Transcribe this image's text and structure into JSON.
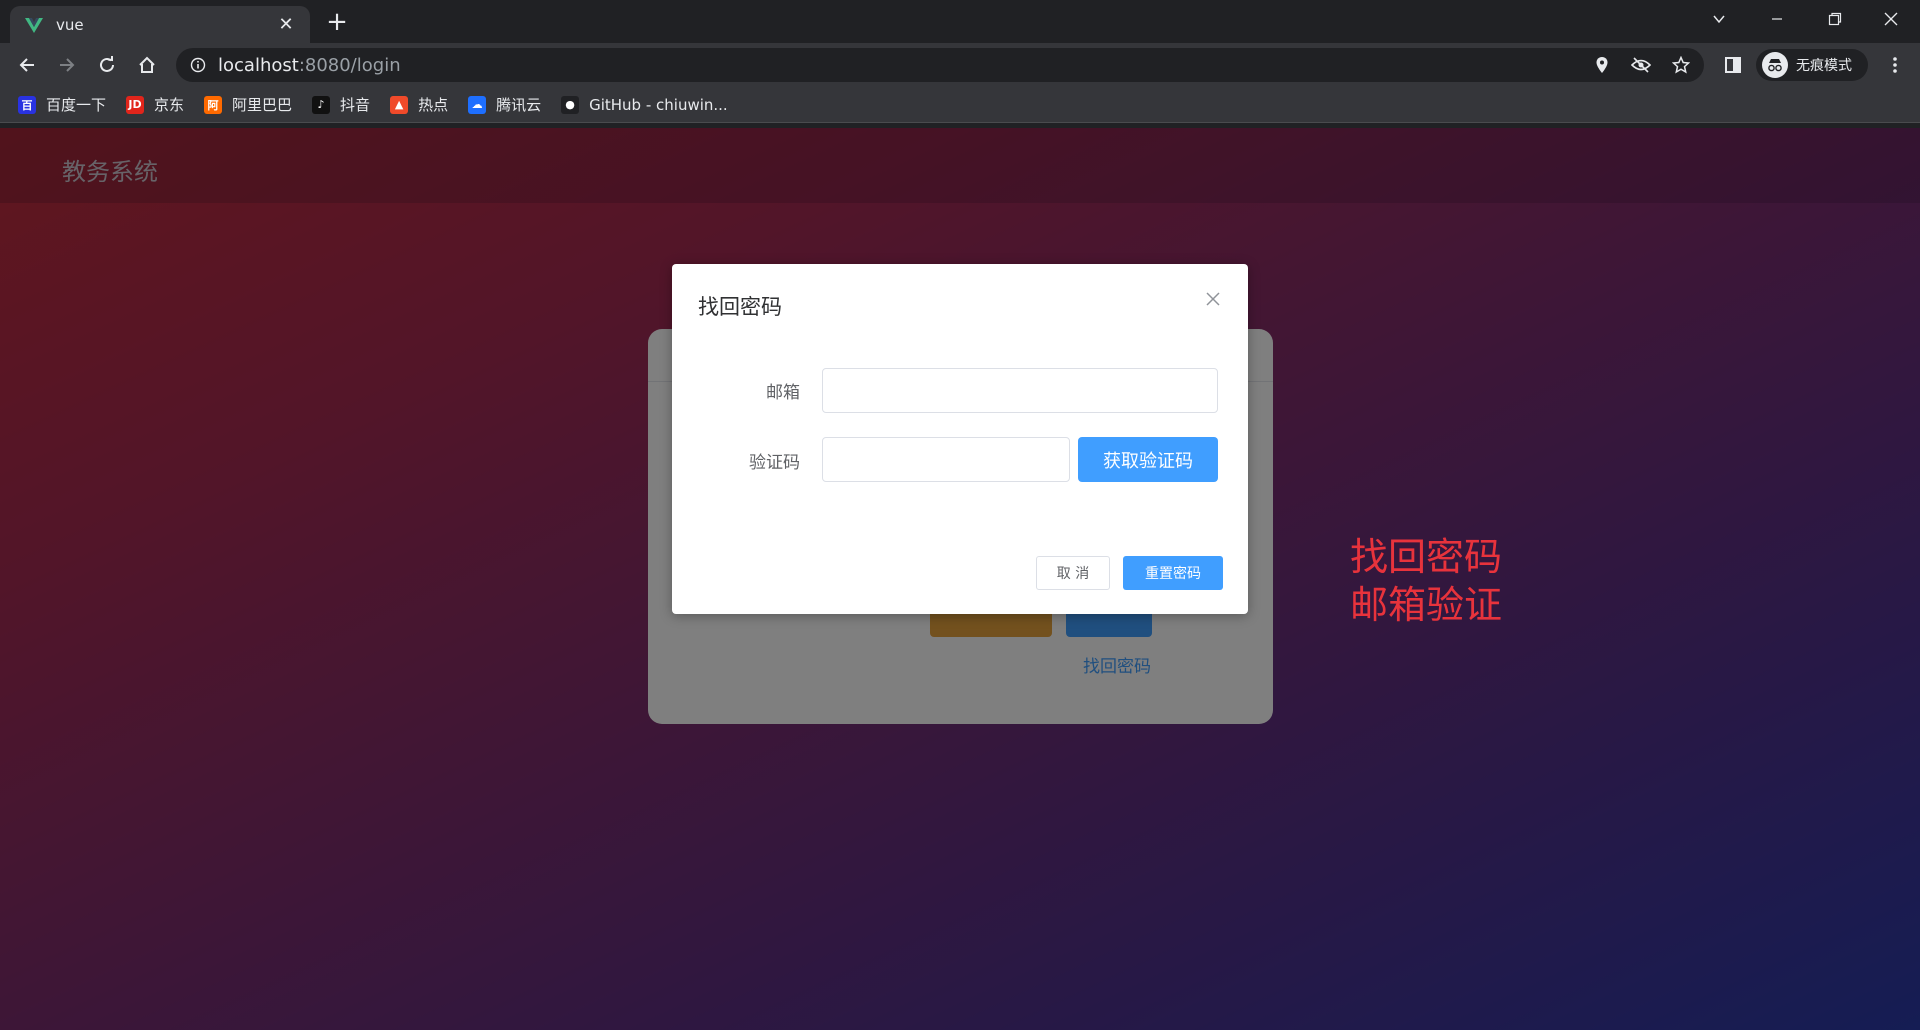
{
  "browser": {
    "tab": {
      "title": "vue",
      "favicon": "vue-logo-icon"
    },
    "address": {
      "host": "localhost",
      "rest": ":8080/login"
    },
    "profile_label": "无痕模式",
    "bookmarks": [
      {
        "label": "百度一下",
        "icon": "baidu-icon",
        "color": "#2932e1",
        "glyph": "百"
      },
      {
        "label": "京东",
        "icon": "jd-icon",
        "color": "#e1251b",
        "glyph": "JD"
      },
      {
        "label": "阿里巴巴",
        "icon": "alibaba-icon",
        "color": "#ff6a00",
        "glyph": "阿"
      },
      {
        "label": "抖音",
        "icon": "douyin-icon",
        "color": "#111111",
        "glyph": "♪"
      },
      {
        "label": "热点",
        "icon": "hot-icon",
        "color": "#f04a2a",
        "glyph": "▲"
      },
      {
        "label": "腾讯云",
        "icon": "tencent-cloud-icon",
        "color": "#1e6fff",
        "glyph": "☁"
      },
      {
        "label": "GitHub - chiuwin...",
        "icon": "github-icon",
        "color": "#202124",
        "glyph": "●"
      }
    ]
  },
  "app": {
    "title": "教务系统",
    "login_card": {
      "forgot_link": "找回密码"
    }
  },
  "dialog": {
    "title": "找回密码",
    "email_label": "邮箱",
    "email_value": "",
    "code_label": "验证码",
    "code_value": "",
    "get_code_button": "获取验证码",
    "cancel_button": "取 消",
    "reset_button": "重置密码"
  },
  "annotation": {
    "line1": "找回密码",
    "line2": "邮箱验证"
  },
  "colors": {
    "primary": "#409eff",
    "warning": "#e6a23c",
    "annotation": "#e8333c"
  }
}
